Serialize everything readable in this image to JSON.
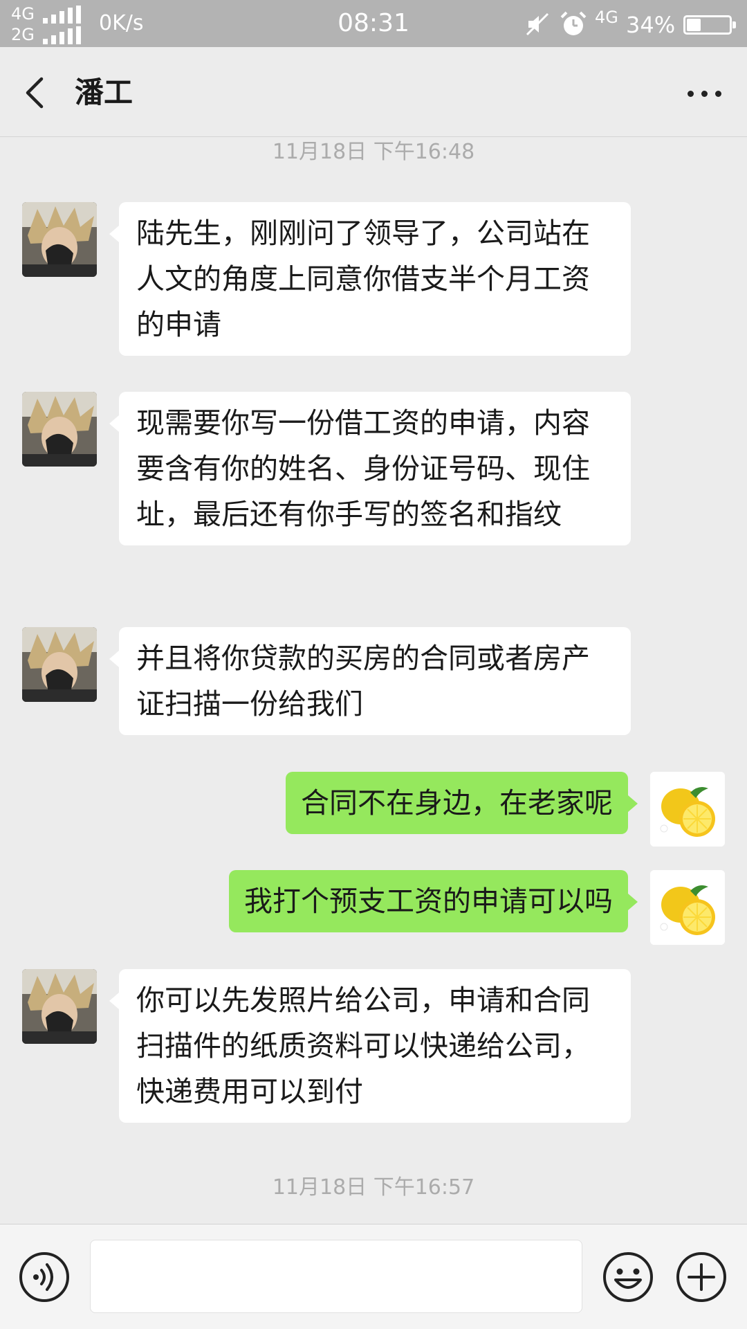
{
  "status_bar": {
    "network_top": "4G",
    "network_bottom": "2G",
    "speed": "0K/s",
    "time": "08:31",
    "network_type": "4G",
    "battery_percent_label": "34%",
    "battery_level": 0.34,
    "icons": [
      "signal-icon",
      "mute-icon",
      "alarm-icon",
      "battery-icon"
    ]
  },
  "header": {
    "title": "潘工",
    "back_icon": "chevron-left-icon",
    "more_icon": "more-icon"
  },
  "messages": [
    {
      "type": "timestamp",
      "text": "11月18日 下午16:48"
    },
    {
      "type": "received",
      "text": "陆先生，刚刚问了领导了，公司站在人文的角度上同意你借支半个月工资的申请"
    },
    {
      "type": "received",
      "text": "现需要你写一份借工资的申请，内容要含有你的姓名、身份证号码、现住址，最后还有你手写的签名和指纹"
    },
    {
      "type": "received",
      "text": "并且将你贷款的买房的合同或者房产证扫描一份给我们"
    },
    {
      "type": "sent",
      "text": "合同不在身边，在老家呢"
    },
    {
      "type": "sent",
      "text": "我打个预支工资的申请可以吗"
    },
    {
      "type": "received",
      "text": "你可以先发照片给公司，申请和合同扫描件的纸质资料可以快递给公司，快递费用可以到付"
    },
    {
      "type": "timestamp",
      "text": "11月18日 下午16:57"
    }
  ],
  "input_bar": {
    "placeholder": "",
    "voice_icon": "voice-icon",
    "emoji_icon": "emoji-icon",
    "plus_icon": "plus-icon"
  },
  "colors": {
    "sent_bubble": "#95e85d",
    "received_bubble": "#ffffff",
    "background": "#ececec",
    "status_bar": "#b3b3b3"
  }
}
